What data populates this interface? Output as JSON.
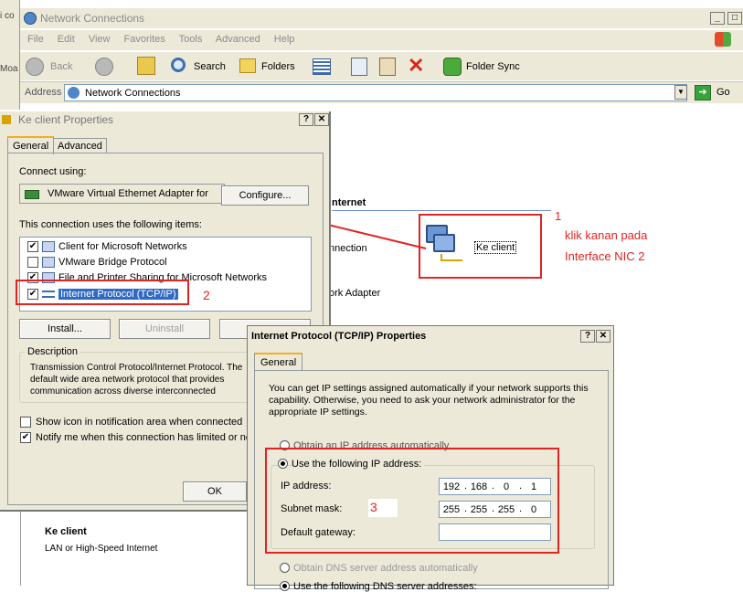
{
  "explorer": {
    "title": "Network Connections",
    "partial_left": [
      "i co",
      "Moa"
    ],
    "menu": [
      "File",
      "Edit",
      "View",
      "Favorites",
      "Tools",
      "Advanced",
      "Help"
    ],
    "toolbar": {
      "back": "Back",
      "search": "Search",
      "folders": "Folders",
      "folder_sync": "Folder Sync"
    },
    "address_label": "Address",
    "address_value": "Network Connections",
    "go": "Go",
    "bg_texts": [
      "nternet",
      "nnection",
      "ork Adapter"
    ],
    "details_title": "Ke client",
    "details_sub": "LAN or High-Speed Internet"
  },
  "annotation": {
    "icon_label": "Ke client",
    "num1": "1",
    "note_line1": "klik kanan pada",
    "note_line2": "Interface NIC 2",
    "num2": "2",
    "num3": "3",
    "colors": {
      "marker": "#e32222"
    }
  },
  "props": {
    "title": "Ke client Properties",
    "tabs": [
      "General",
      "Advanced"
    ],
    "connect_using": "Connect using:",
    "adapter": "VMware Virtual Ethernet Adapter for",
    "configure": "Configure...",
    "items_label": "This connection uses the following items:",
    "items": [
      {
        "label": "Client for Microsoft Networks",
        "checked": true
      },
      {
        "label": "VMware Bridge Protocol",
        "checked": false
      },
      {
        "label": "File and Printer Sharing for Microsoft Networks",
        "checked": true
      },
      {
        "label": "Internet Protocol (TCP/IP)",
        "checked": true
      }
    ],
    "install": "Install...",
    "uninstall": "Uninstall",
    "description_label": "Description",
    "description": "Transmission Control Protocol/Internet Protocol. The default wide area network protocol that provides communication across diverse interconnected networks.",
    "show_icon": "Show icon in notification area when connected",
    "notify": "Notify me when this connection has limited or no connectivity",
    "ok": "OK"
  },
  "tcpip": {
    "title": "Internet Protocol (TCP/IP) Properties",
    "tab": "General",
    "intro": "You can get IP settings assigned automatically if your network supports this capability. Otherwise, you need to ask your network administrator for the appropriate IP settings.",
    "obtain_auto": "Obtain an IP address automatically",
    "use_following": "Use the following IP address:",
    "ip_label": "IP address:",
    "ip": [
      "192",
      "168",
      "0",
      "1"
    ],
    "mask_label": "Subnet mask:",
    "mask": [
      "255",
      "255",
      "255",
      "0"
    ],
    "gateway_label": "Default gateway:",
    "gateway": [
      "",
      "",
      "",
      ""
    ],
    "obtain_dns": "Obtain DNS server address automatically",
    "use_dns": "Use the following DNS server addresses:"
  }
}
